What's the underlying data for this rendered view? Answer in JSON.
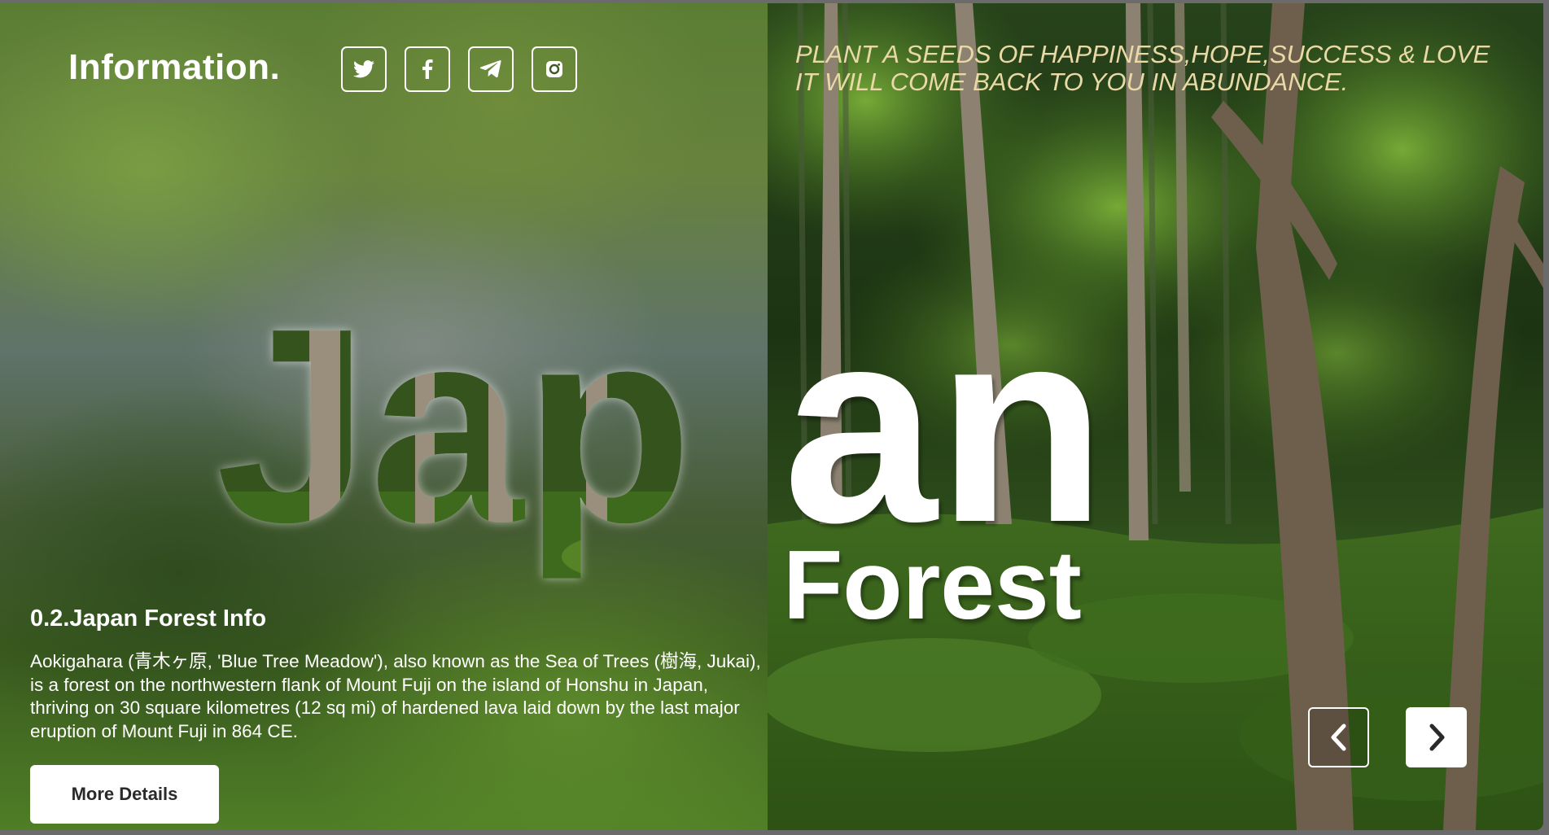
{
  "header": {
    "brand": "Information.",
    "socials": [
      {
        "icon": "twitter-icon"
      },
      {
        "icon": "facebook-icon"
      },
      {
        "icon": "telegram-icon"
      },
      {
        "icon": "instagram-icon"
      }
    ]
  },
  "quote": {
    "line1": "PLANT A SEEDS OF HAPPINESS,HOPE,SUCCESS & LOVE",
    "line2": "IT WILL COME BACK TO YOU IN ABUNDANCE."
  },
  "hero": {
    "word_left": "Jap",
    "word_right": "an",
    "subtitle": "Forest"
  },
  "info": {
    "title": "0.2.Japan Forest Info",
    "description": "Aokigahara (青木ヶ原, 'Blue Tree Meadow'), also known as the Sea of Trees (樹海, Jukai), is a forest on the northwestern flank of Mount Fuji on the island of Honshu in Japan, thriving on 30 square kilometres (12 sq mi) of hardened lava laid down by the last major eruption of Mount Fuji in 864 CE.",
    "button_label": "More Details"
  },
  "slider": {
    "prev_icon": "chevron-left-icon",
    "next_icon": "chevron-right-icon"
  },
  "colors": {
    "quote": "#e9d9a6",
    "text": "#ffffff",
    "button_bg": "#ffffff"
  }
}
